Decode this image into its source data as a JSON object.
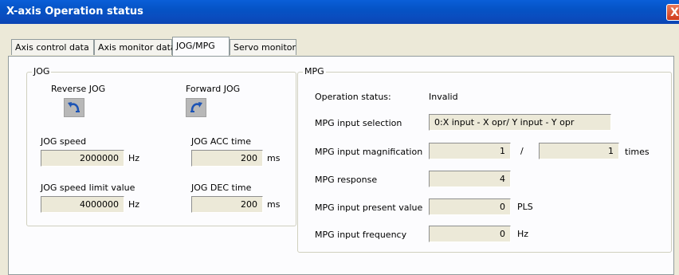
{
  "window": {
    "title": "X-axis Operation status",
    "close_label": "X"
  },
  "tabs": [
    {
      "label": "Axis control data"
    },
    {
      "label": "Axis monitor data"
    },
    {
      "label": "JOG/MPG"
    },
    {
      "label": "Servo monitor"
    }
  ],
  "active_tab": "JOG/MPG",
  "jog": {
    "group_label": "JOG",
    "reverse_label": "Reverse JOG",
    "forward_label": "Forward JOG",
    "reverse_icon": "reverse-arrow-icon",
    "forward_icon": "forward-arrow-icon",
    "speed_label": "JOG speed",
    "speed_value": "2000000",
    "speed_unit": "Hz",
    "acc_label": "JOG ACC time",
    "acc_value": "200",
    "acc_unit": "ms",
    "limit_label": "JOG speed limit value",
    "limit_value": "4000000",
    "limit_unit": "Hz",
    "dec_label": "JOG DEC time",
    "dec_value": "200",
    "dec_unit": "ms"
  },
  "mpg": {
    "group_label": "MPG",
    "op_status_label": "Operation status:",
    "op_status_value": "Invalid",
    "input_selection_label": "MPG input selection",
    "input_selection_value": "0:X input - X opr/ Y input - Y opr",
    "magnification_label": "MPG input magnification",
    "magnification_numerator": "1",
    "magnification_separator": "/",
    "magnification_denominator": "1",
    "magnification_unit": "times",
    "response_label": "MPG response",
    "response_value": "4",
    "present_label": "MPG input present value",
    "present_value": "0",
    "present_unit": "PLS",
    "frequency_label": "MPG input frequency",
    "frequency_value": "0",
    "frequency_unit": "Hz"
  }
}
